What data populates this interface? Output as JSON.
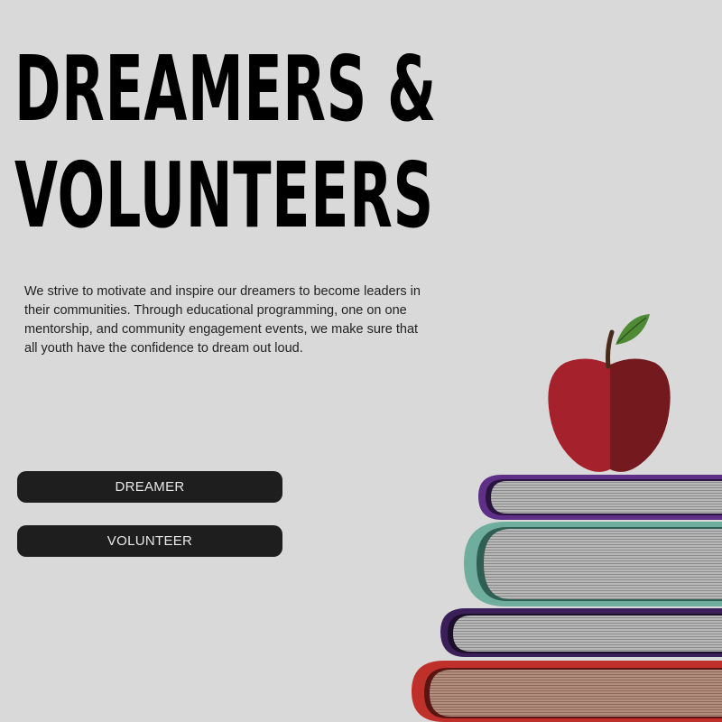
{
  "hero": {
    "title_line1": "DREAMERS &",
    "title_line2": "VOLUNTEERS"
  },
  "intro": {
    "text": "We strive to motivate and inspire our dreamers to become leaders in their communities. Through educational programming, one on one mentorship, and community engagement events, we make sure that all youth have the confidence to dream out loud."
  },
  "buttons": {
    "dreamer_label": "DREAMER",
    "volunteer_label": "VOLUNTEER"
  },
  "illustration": {
    "icon": "apple-on-books-icon",
    "colors": {
      "apple_light": "#a5212c",
      "apple_dark": "#741a1f",
      "leaf": "#4f8a35",
      "book1_cover": "#5e2f86",
      "book2_cover": "#6fae9c",
      "book3_cover": "#3a1f58",
      "book4_cover": "#c0302a"
    }
  }
}
